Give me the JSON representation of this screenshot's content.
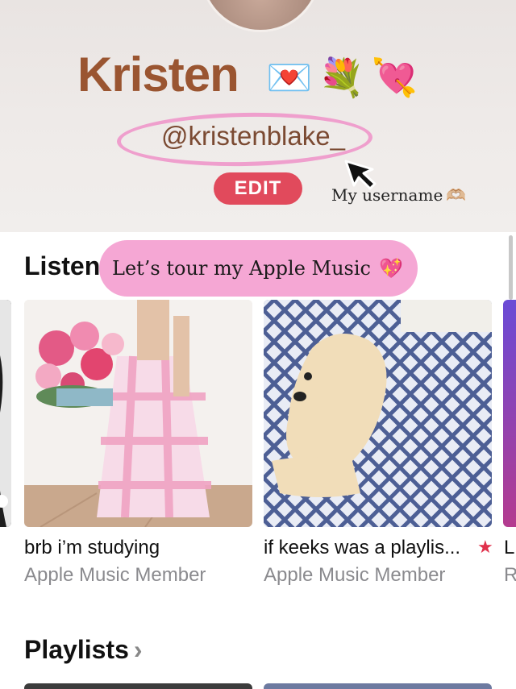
{
  "profile": {
    "name": "Kristen",
    "name_emojis": [
      "💌",
      "💐",
      "💘"
    ],
    "username": "@kristenblake_",
    "edit_label": "EDIT",
    "annotation": "My username",
    "annotation_emoji": "🫶🏼"
  },
  "listening": {
    "section_title": "Listening",
    "callout": "Let’s tour my Apple Music",
    "callout_emoji": "💖",
    "items": [
      {
        "title": "brb i’m studying",
        "subtitle": "Apple Music Member"
      },
      {
        "title": "if keeks was a playlis...",
        "subtitle": "Apple Music Member",
        "starred": true
      },
      {
        "title": "L",
        "subtitle": "R"
      }
    ]
  },
  "playlists": {
    "section_title": "Playlists",
    "chevron": "›"
  },
  "colors": {
    "accent": "#e14a5c",
    "name": "#9a5531",
    "highlight": "#f5a7d4",
    "star": "#e0304b"
  }
}
